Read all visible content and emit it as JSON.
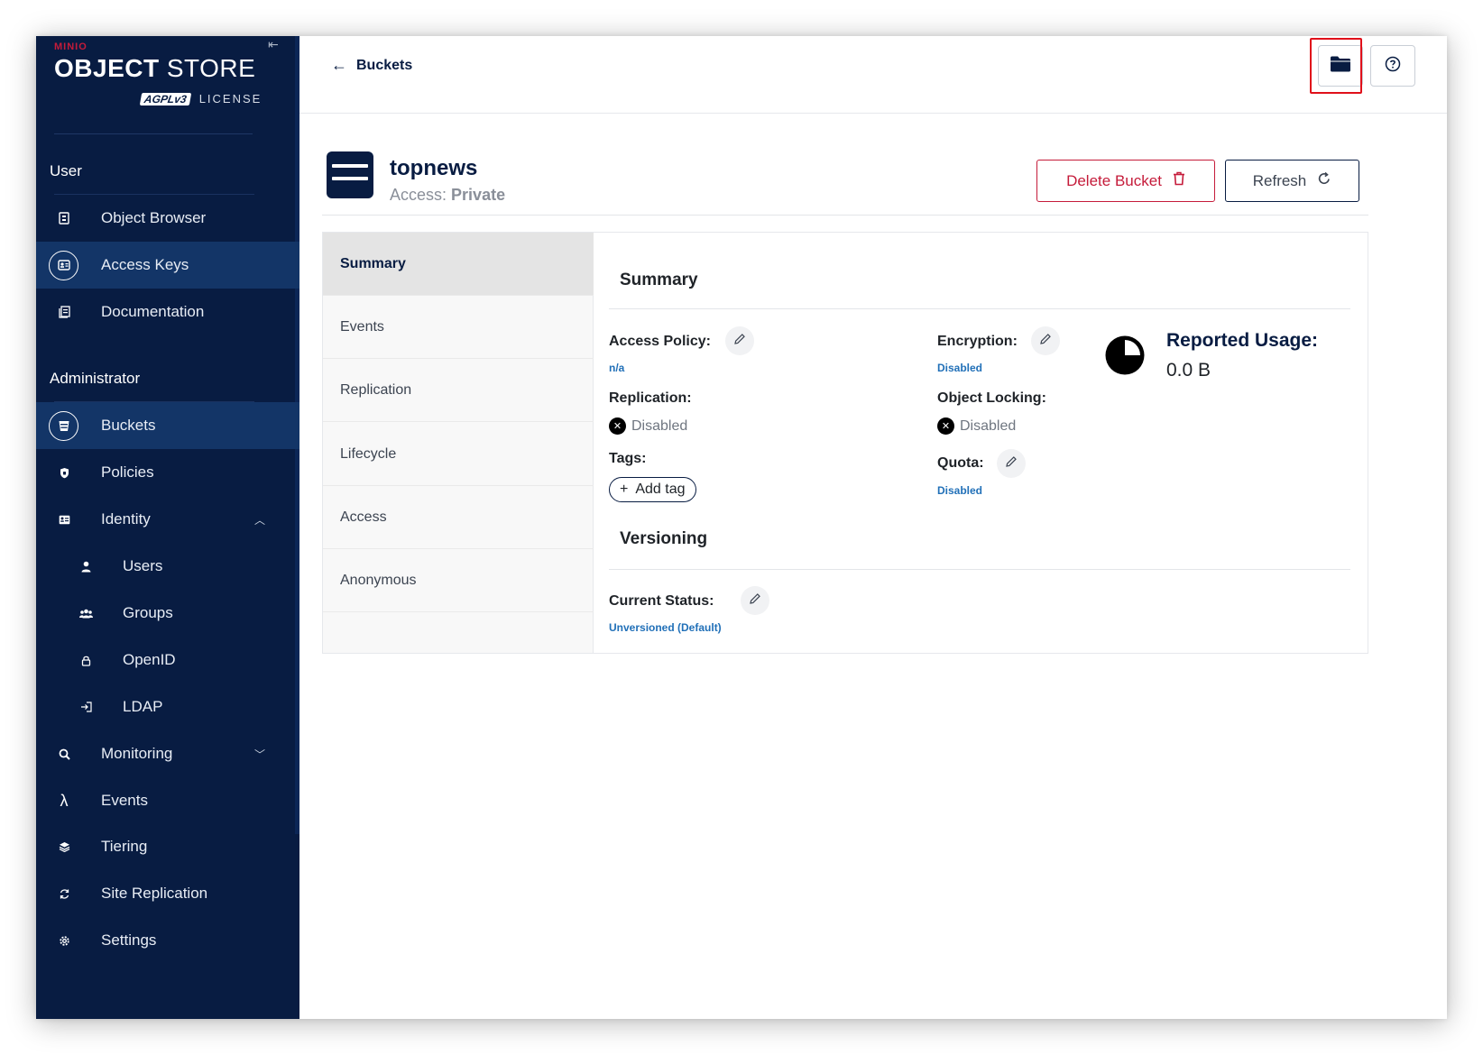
{
  "logo": {
    "brand": "MINIO",
    "product_bold": "OBJECT",
    "product_light": "STORE",
    "badge": "AGPLv3",
    "license": "LICENSE"
  },
  "sidebar": {
    "user_section": "User",
    "user_items": [
      {
        "label": "Object Browser",
        "icon": "object-browser-icon"
      },
      {
        "label": "Access Keys",
        "icon": "access-keys-icon"
      },
      {
        "label": "Documentation",
        "icon": "documentation-icon"
      }
    ],
    "admin_section": "Administrator",
    "admin_items": [
      {
        "label": "Buckets",
        "icon": "bucket-icon"
      },
      {
        "label": "Policies",
        "icon": "shield-icon"
      },
      {
        "label": "Identity",
        "icon": "identity-icon"
      },
      {
        "label": "Users",
        "icon": "user-icon"
      },
      {
        "label": "Groups",
        "icon": "group-icon"
      },
      {
        "label": "OpenID",
        "icon": "lock-icon"
      },
      {
        "label": "LDAP",
        "icon": "login-icon"
      },
      {
        "label": "Monitoring",
        "icon": "monitoring-icon"
      },
      {
        "label": "Events",
        "icon": "lambda-icon"
      },
      {
        "label": "Tiering",
        "icon": "tiering-icon"
      },
      {
        "label": "Site Replication",
        "icon": "site-replication-icon"
      },
      {
        "label": "Settings",
        "icon": "gear-icon"
      }
    ]
  },
  "topbar": {
    "back_label": "Buckets"
  },
  "bucket": {
    "name": "topnews",
    "access_label": "Access:",
    "access_value": "Private",
    "delete_label": "Delete Bucket",
    "refresh_label": "Refresh"
  },
  "tabs": [
    "Summary",
    "Events",
    "Replication",
    "Lifecycle",
    "Access",
    "Anonymous"
  ],
  "summary": {
    "title": "Summary",
    "access_policy_label": "Access Policy:",
    "access_policy_value": "n/a",
    "encryption_label": "Encryption:",
    "encryption_value": "Disabled",
    "replication_label": "Replication:",
    "replication_value": "Disabled",
    "object_locking_label": "Object Locking:",
    "object_locking_value": "Disabled",
    "tags_label": "Tags:",
    "add_tag_label": "Add tag",
    "quota_label": "Quota:",
    "quota_value": "Disabled",
    "usage_label": "Reported Usage:",
    "usage_value": "0.0 B"
  },
  "versioning": {
    "title": "Versioning",
    "status_label": "Current Status:",
    "status_value": "Unversioned (Default)"
  },
  "colors": {
    "navy": "#081c42",
    "active_nav": "#133567",
    "danger": "#c51b3a",
    "link": "#2170b8",
    "highlight": "#e0101a"
  }
}
